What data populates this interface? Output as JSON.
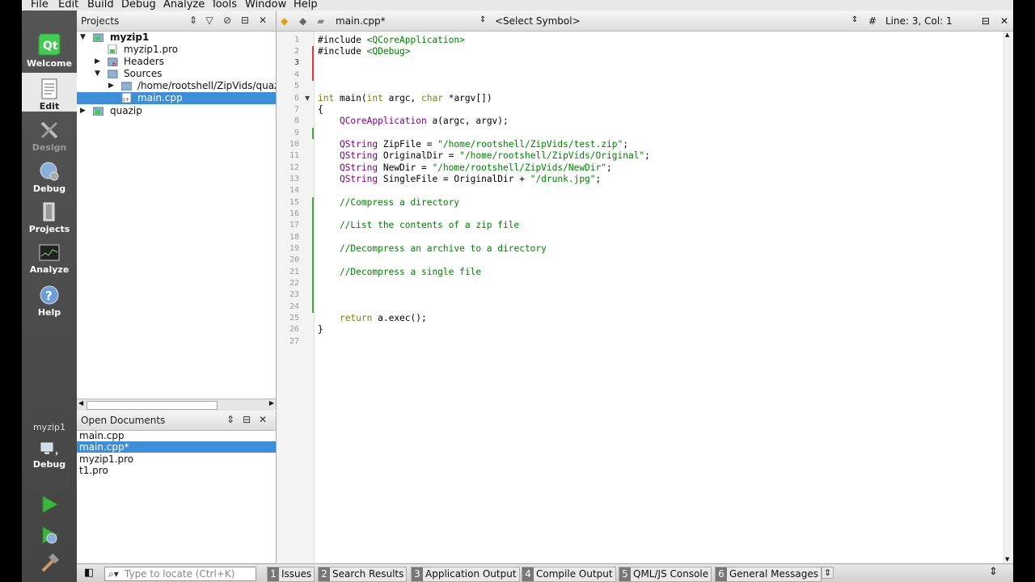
{
  "menu": [
    "File",
    "Edit",
    "Build",
    "Debug",
    "Analyze",
    "Tools",
    "Window",
    "Help"
  ],
  "modes": [
    "Welcome",
    "Edit",
    "Design",
    "Debug",
    "Projects",
    "Analyze",
    "Help"
  ],
  "target": {
    "project": "myzip1",
    "mode": "Debug"
  },
  "projects": {
    "title": "Projects",
    "tree": [
      {
        "label": "myzip1",
        "bold": true
      },
      {
        "label": "myzip1.pro"
      },
      {
        "label": "Headers"
      },
      {
        "label": "Sources"
      },
      {
        "label": "/home/rootshell/ZipVids/quazip"
      },
      {
        "label": "main.cpp"
      },
      {
        "label": "quazip"
      }
    ]
  },
  "open_documents": {
    "title": "Open Documents",
    "items": [
      "main.cpp",
      "main.cpp*",
      "myzip1.pro",
      "t1.pro"
    ]
  },
  "editor": {
    "file": "main.cpp*",
    "symbol": "<Select Symbol>",
    "hash": "#",
    "position": "Line: 3, Col: 1",
    "lines": [
      "1",
      "2",
      "3",
      "4",
      "5",
      "6",
      "7",
      "8",
      "9",
      "10",
      "11",
      "12",
      "13",
      "14",
      "15",
      "16",
      "17",
      "18",
      "19",
      "20",
      "21",
      "22",
      "23",
      "24",
      "25",
      "26",
      "27"
    ]
  },
  "code": {
    "l1a": "#include ",
    "l1b": "<QCoreApplication>",
    "l2a": "#include ",
    "l2b": "<QDebug>",
    "l6a": "int",
    "l6b": " main(",
    "l6c": "int",
    "l6d": " argc, ",
    "l6e": "char",
    "l6f": " *argv[])",
    "l7": "{",
    "l8a": "    ",
    "l8b": "QCoreApplication",
    "l8c": " a(argc, argv);",
    "l10a": "    ",
    "l10b": "QString",
    "l10c": " ZipFile = ",
    "l10d": "\"/home/rootshell/ZipVids/test.zip\"",
    "l10e": ";",
    "l11a": "    ",
    "l11b": "QString",
    "l11c": " OriginalDir = ",
    "l11d": "\"/home/rootshell/ZipVids/Original\"",
    "l11e": ";",
    "l12a": "    ",
    "l12b": "QString",
    "l12c": " NewDir = ",
    "l12d": "\"/home/rootshell/ZipVids/NewDir\"",
    "l12e": ";",
    "l13a": "    ",
    "l13b": "QString",
    "l13c": " SingleFile = OriginalDir + ",
    "l13d": "\"/drunk.jpg\"",
    "l13e": ";",
    "l15": "    //Compress a directory",
    "l17": "    //List the contents of a zip file",
    "l19": "    //Decompress an archive to a directory",
    "l21": "    //Decompress a single file",
    "l25a": "    ",
    "l25b": "return",
    "l25c": " a.exec();",
    "l26": "}"
  },
  "bottom": {
    "locate_placeholder": "Type to locate (Ctrl+K)",
    "tabs": [
      {
        "n": "1",
        "label": "Issues"
      },
      {
        "n": "2",
        "label": "Search Results"
      },
      {
        "n": "3",
        "label": "Application Output"
      },
      {
        "n": "4",
        "label": "Compile Output"
      },
      {
        "n": "5",
        "label": "QML/JS Console"
      },
      {
        "n": "6",
        "label": "General Messages"
      }
    ]
  }
}
